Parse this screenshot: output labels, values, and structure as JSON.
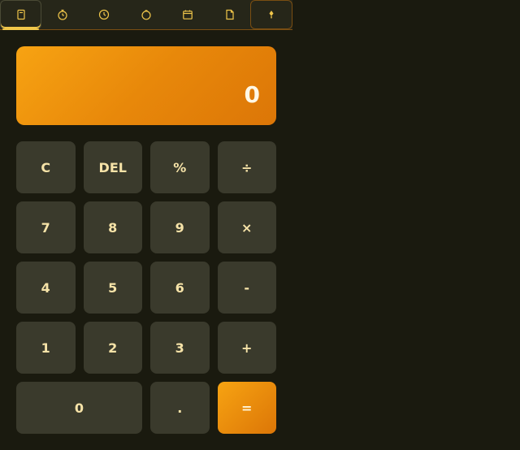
{
  "toolbar": {
    "tabs": [
      {
        "icon": "calculator-icon",
        "active": true
      },
      {
        "icon": "stopwatch-icon"
      },
      {
        "icon": "clock-icon"
      },
      {
        "icon": "timer-icon"
      },
      {
        "icon": "calendar-icon"
      },
      {
        "icon": "notes-icon"
      }
    ],
    "theme_icon": "palette-icon"
  },
  "display": {
    "value": "0"
  },
  "keys": {
    "clear": "C",
    "delete": "DEL",
    "percent": "%",
    "divide": "÷",
    "seven": "7",
    "eight": "8",
    "nine": "9",
    "multiply": "×",
    "four": "4",
    "five": "5",
    "six": "6",
    "subtract": "-",
    "one": "1",
    "two": "2",
    "three": "3",
    "add": "+",
    "zero": "0",
    "decimal": ".",
    "equals": "="
  },
  "colors": {
    "accent": "#f0c64a",
    "display_gradient_start": "#f7a312",
    "display_gradient_end": "#dc7607",
    "key_bg": "#3a3a2c",
    "background": "#1a1a0f"
  }
}
